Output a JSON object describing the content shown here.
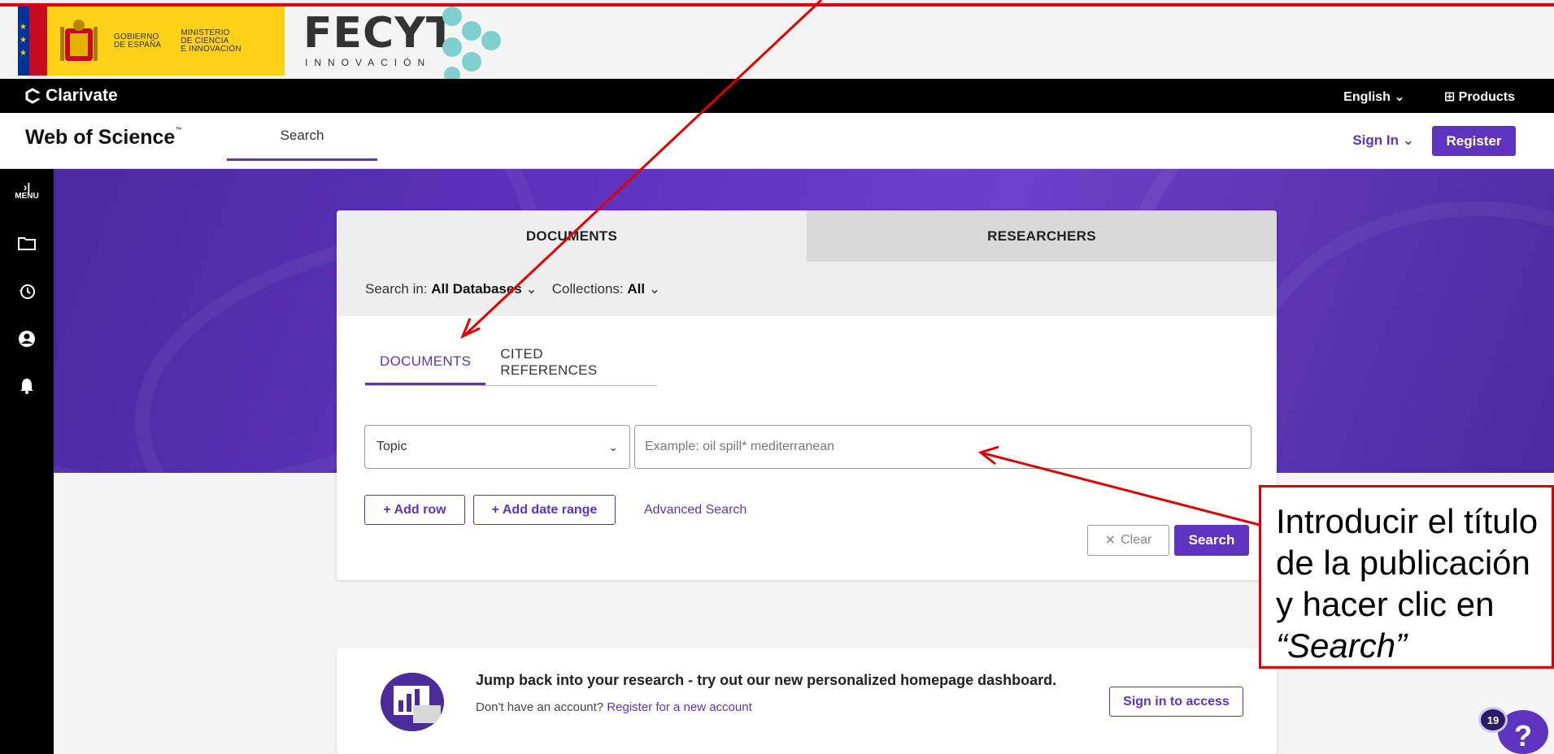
{
  "gov_banner": {
    "gobierno": [
      "GOBIERNO",
      "DE ESPAÑA"
    ],
    "ministerio": [
      "MINISTERIO",
      "DE CIENCIA",
      "E INNOVACIÓN"
    ],
    "fecyt_word": "FECYT",
    "fecyt_sub": "INNOVACIÓN"
  },
  "clarivate": {
    "brand": "Clarivate",
    "language": "English",
    "products": "Products"
  },
  "wos_header": {
    "title": "Web of Science",
    "tm": "™",
    "tab_search": "Search",
    "sign_in": "Sign In",
    "register": "Register"
  },
  "rail": {
    "menu_label": "MENU",
    "icons": [
      "expand-icon",
      "folder-icon",
      "history-icon",
      "user-icon",
      "bell-icon"
    ]
  },
  "search_card": {
    "top_tabs": [
      "DOCUMENTS",
      "RESEARCHERS"
    ],
    "search_in_label": "Search in:",
    "search_in_value": "All Databases",
    "collections_label": "Collections:",
    "collections_value": "All",
    "sub_tabs": [
      "DOCUMENTS",
      "CITED REFERENCES"
    ],
    "field_value": "Topic",
    "query_placeholder": "Example: oil spill* mediterranean",
    "add_row": "+ Add row",
    "add_date_range": "+ Add date range",
    "advanced_search": "Advanced Search",
    "clear": "Clear",
    "search": "Search"
  },
  "promo": {
    "title": "Jump back into your research - try out our new personalized homepage dashboard.",
    "no_account": "Don't have an account?",
    "register_link": "Register for a new account",
    "button": "Sign in to access"
  },
  "help": {
    "badge": "19",
    "glyph": "?"
  },
  "annotation": {
    "line1": "Introducir el título",
    "line2": "de la publicación",
    "line3": "y hacer clic en",
    "line4": "“Search”",
    "color": "#e10000"
  },
  "colors": {
    "accent": "#5e33bf",
    "hero": "#5e33bf",
    "annotation": "#e10000"
  }
}
